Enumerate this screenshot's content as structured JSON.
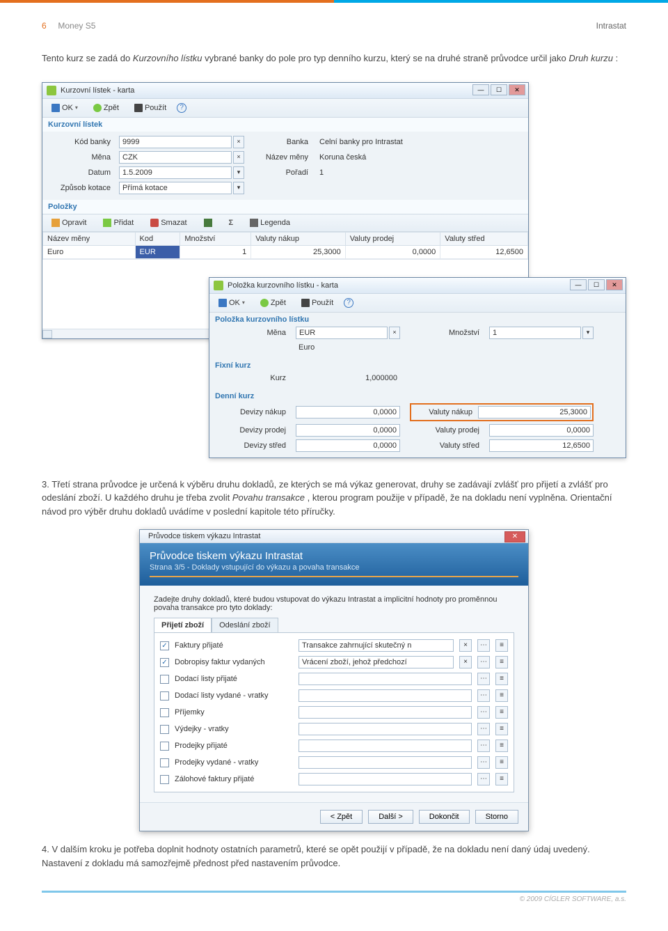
{
  "header": {
    "pageNum": "6",
    "product": "Money S5",
    "section": "Intrastat"
  },
  "para1_pre": "Tento kurz se zadá do ",
  "para1_i1": "Kurzovního lístku",
  "para1_mid": " vybrané banky do pole pro typ denního kurzu, který se na druhé straně průvodce určil jako ",
  "para1_i2": "Druh kurzu",
  "para1_post": ":",
  "win1": {
    "title": "Kurzovní lístek - karta",
    "tb": {
      "ok": "OK",
      "zpet": "Zpět",
      "pouzit": "Použít"
    },
    "sec1": "Kurzovní lístek",
    "labels": {
      "kod": "Kód banky",
      "mena": "Měna",
      "datum": "Datum",
      "zpusob": "Způsob kotace",
      "banka": "Banka",
      "nazevMeny": "Název měny",
      "poradi": "Pořadí"
    },
    "vals": {
      "kod": "9999",
      "mena": "CZK",
      "datum": "1.5.2009",
      "zpusob": "Přímá kotace",
      "banka": "Celní banky pro Intrastat",
      "nazevMeny": "Koruna česká",
      "poradi": "1"
    },
    "sec2": "Položky",
    "subtb": {
      "opravit": "Opravit",
      "pridat": "Přidat",
      "smazat": "Smazat",
      "legenda": "Legenda"
    },
    "cols": [
      "Název měny",
      "Kod",
      "Množství",
      "Valuty nákup",
      "Valuty prodej",
      "Valuty střed"
    ],
    "row": [
      "Euro",
      "EUR",
      "1",
      "25,3000",
      "0,0000",
      "12,6500"
    ]
  },
  "win2": {
    "title": "Položka kurzovního lístku - karta",
    "tb": {
      "ok": "OK",
      "zpet": "Zpět",
      "pouzit": "Použít"
    },
    "sec1": "Položka kurzovního lístku",
    "labels": {
      "mena": "Měna",
      "mnozstvi": "Množství",
      "euro": "Euro"
    },
    "vals": {
      "mena": "EUR",
      "mnozstvi": "1"
    },
    "sec2": "Fixní kurz",
    "kurzLbl": "Kurz",
    "kurzVal": "1,000000",
    "sec3": "Denní kurz",
    "left": [
      {
        "l": "Devizy nákup",
        "v": "0,0000"
      },
      {
        "l": "Devizy prodej",
        "v": "0,0000"
      },
      {
        "l": "Devizy střed",
        "v": "0,0000"
      }
    ],
    "right": [
      {
        "l": "Valuty nákup",
        "v": "25,3000",
        "hl": true
      },
      {
        "l": "Valuty prodej",
        "v": "0,0000"
      },
      {
        "l": "Valuty střed",
        "v": "12,6500"
      }
    ]
  },
  "para3": "3. Třetí strana průvodce je určená k výběru druhu dokladů, ze kterých se má výkaz generovat, druhy se zadávají zvlášť pro přijetí a zvlášť pro odeslání zboží. U každého druhu je třeba zvolit ",
  "para3_i": "Povahu transakce",
  "para3_post": ", kterou program použije v případě, že na dokladu není vyplněna. Orientační návod pro výběr druhu dokladů uvádíme v poslední kapitole této příručky.",
  "wizard": {
    "title": "Průvodce tiskem výkazu Intrastat",
    "bannerTitle": "Průvodce tiskem výkazu Intrastat",
    "bannerSub": "Strana 3/5 - Doklady vstupující do výkazu a povaha transakce",
    "intro": "Zadejte druhy dokladů, které budou vstupovat do výkazu Intrastat a implicitní hodnoty pro proměnnou povaha transakce pro tyto doklady:",
    "tabs": [
      "Přijetí zboží",
      "Odeslání zboží"
    ],
    "rows": [
      {
        "checked": true,
        "label": "Faktury přijaté",
        "txn": "Transakce zahrnující skutečný n"
      },
      {
        "checked": true,
        "label": "Dobropisy faktur vydaných",
        "txn": "Vrácení zboží, jehož předchozí"
      },
      {
        "checked": false,
        "label": "Dodací listy přijaté",
        "txn": ""
      },
      {
        "checked": false,
        "label": "Dodací listy vydané - vratky",
        "txn": ""
      },
      {
        "checked": false,
        "label": "Příjemky",
        "txn": ""
      },
      {
        "checked": false,
        "label": "Výdejky - vratky",
        "txn": ""
      },
      {
        "checked": false,
        "label": "Prodejky přijaté",
        "txn": ""
      },
      {
        "checked": false,
        "label": "Prodejky vydané - vratky",
        "txn": ""
      },
      {
        "checked": false,
        "label": "Zálohové faktury přijaté",
        "txn": ""
      }
    ],
    "buttons": {
      "zpet": "< Zpět",
      "dalsi": "Další >",
      "dokoncit": "Dokončit",
      "storno": "Storno"
    }
  },
  "para4": "4. V dalším kroku je potřeba doplnit hodnoty ostatních parametrů, které se opět použijí v případě, že na dokladu není daný údaj uvedený. Nastavení z dokladu má samozřejmě přednost před nastavením průvodce.",
  "copyright": "© 2009 CÍGLER SOFTWARE, a.s."
}
